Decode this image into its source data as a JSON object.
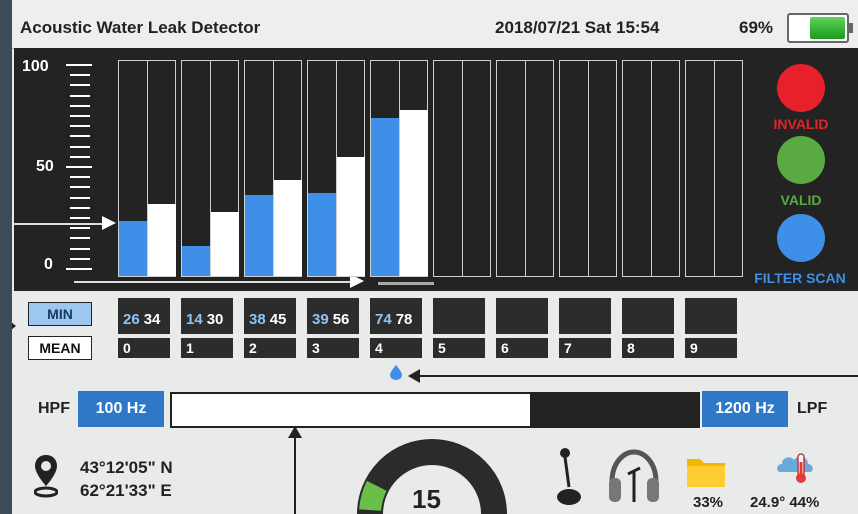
{
  "header": {
    "title": "Acoustic Water Leak Detector",
    "datetime": "2018/07/21 Sat 15:54",
    "battery_percent": "69%",
    "battery_level": 0.69
  },
  "graph": {
    "y_labels": {
      "top": "100",
      "mid": "50",
      "bottom": "0"
    },
    "colors": {
      "min": "#3d8fe8",
      "mean": "#ffffff"
    },
    "selected_channel": 4,
    "channels": [
      {
        "id": "0",
        "min": 26,
        "mean": 34,
        "min_text": "26",
        "mean_text": "34"
      },
      {
        "id": "1",
        "min": 14,
        "mean": 30,
        "min_text": "14",
        "mean_text": "30"
      },
      {
        "id": "2",
        "min": 38,
        "mean": 45,
        "min_text": "38",
        "mean_text": "45"
      },
      {
        "id": "3",
        "min": 39,
        "mean": 56,
        "min_text": "39",
        "mean_text": "56"
      },
      {
        "id": "4",
        "min": 74,
        "mean": 78,
        "min_text": "74",
        "mean_text": "78"
      },
      {
        "id": "5",
        "min": null,
        "mean": null,
        "min_text": "",
        "mean_text": ""
      },
      {
        "id": "6",
        "min": null,
        "mean": null,
        "min_text": "",
        "mean_text": ""
      },
      {
        "id": "7",
        "min": null,
        "mean": null,
        "min_text": "",
        "mean_text": ""
      },
      {
        "id": "8",
        "min": null,
        "mean": null,
        "min_text": "",
        "mean_text": ""
      },
      {
        "id": "9",
        "min": null,
        "mean": null,
        "min_text": "",
        "mean_text": ""
      }
    ]
  },
  "indicators": {
    "invalid": {
      "label": "INVALID",
      "color": "#e8202a"
    },
    "valid": {
      "label": "VALID",
      "color": "#5aaa42"
    },
    "filter_scan": {
      "label": "FILTER SCAN",
      "color": "#3d8fe8"
    }
  },
  "mode_buttons": {
    "min": "MIN",
    "mean": "MEAN"
  },
  "filter": {
    "hpf_label": "HPF",
    "hpf_value": "100 Hz",
    "lpf_label": "LPF",
    "lpf_value": "1200 Hz",
    "band_fill_fraction": 0.68
  },
  "gps": {
    "lat": "43°12'05\" N",
    "lon": "62°21'33\" E"
  },
  "gauge": {
    "value": "15",
    "level": 0.15
  },
  "status": {
    "storage": "33%",
    "temp_humidity": "24.9° 44%"
  },
  "icons": [
    "location-pin-icon",
    "microphone-icon",
    "headphones-icon",
    "folder-icon",
    "thermometer-cloud-icon",
    "water-drop-icon"
  ]
}
